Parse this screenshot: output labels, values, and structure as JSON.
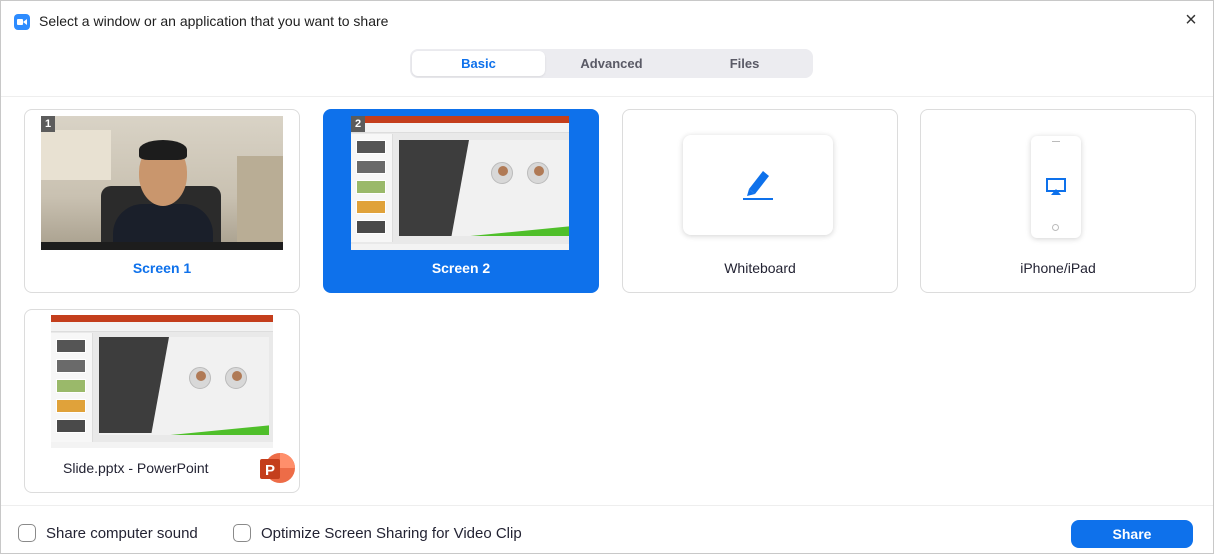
{
  "window": {
    "title": "Select a window or an application that you want to share",
    "close_symbol": "×"
  },
  "tabs": [
    {
      "label": "Basic",
      "active": true
    },
    {
      "label": "Advanced",
      "active": false
    },
    {
      "label": "Files",
      "active": false
    }
  ],
  "share_options": {
    "screen1": {
      "number": "1",
      "label": "Screen 1",
      "selected": false
    },
    "screen2": {
      "number": "2",
      "label": "Screen 2",
      "selected": true
    },
    "whiteboard": {
      "label": "Whiteboard",
      "icon": "pen-icon"
    },
    "iphone": {
      "label": "iPhone/iPad",
      "icon": "airplay-icon"
    },
    "app_window": {
      "label": "Slide.pptx - PowerPoint",
      "icon": "powerpoint-icon"
    }
  },
  "footer": {
    "share_sound_label": "Share computer sound",
    "share_sound_checked": false,
    "optimize_label": "Optimize Screen Sharing for Video Clip",
    "optimize_checked": false,
    "share_button_label": "Share"
  },
  "colors": {
    "accent": "#0e71eb",
    "powerpoint": "#c43e1c"
  }
}
